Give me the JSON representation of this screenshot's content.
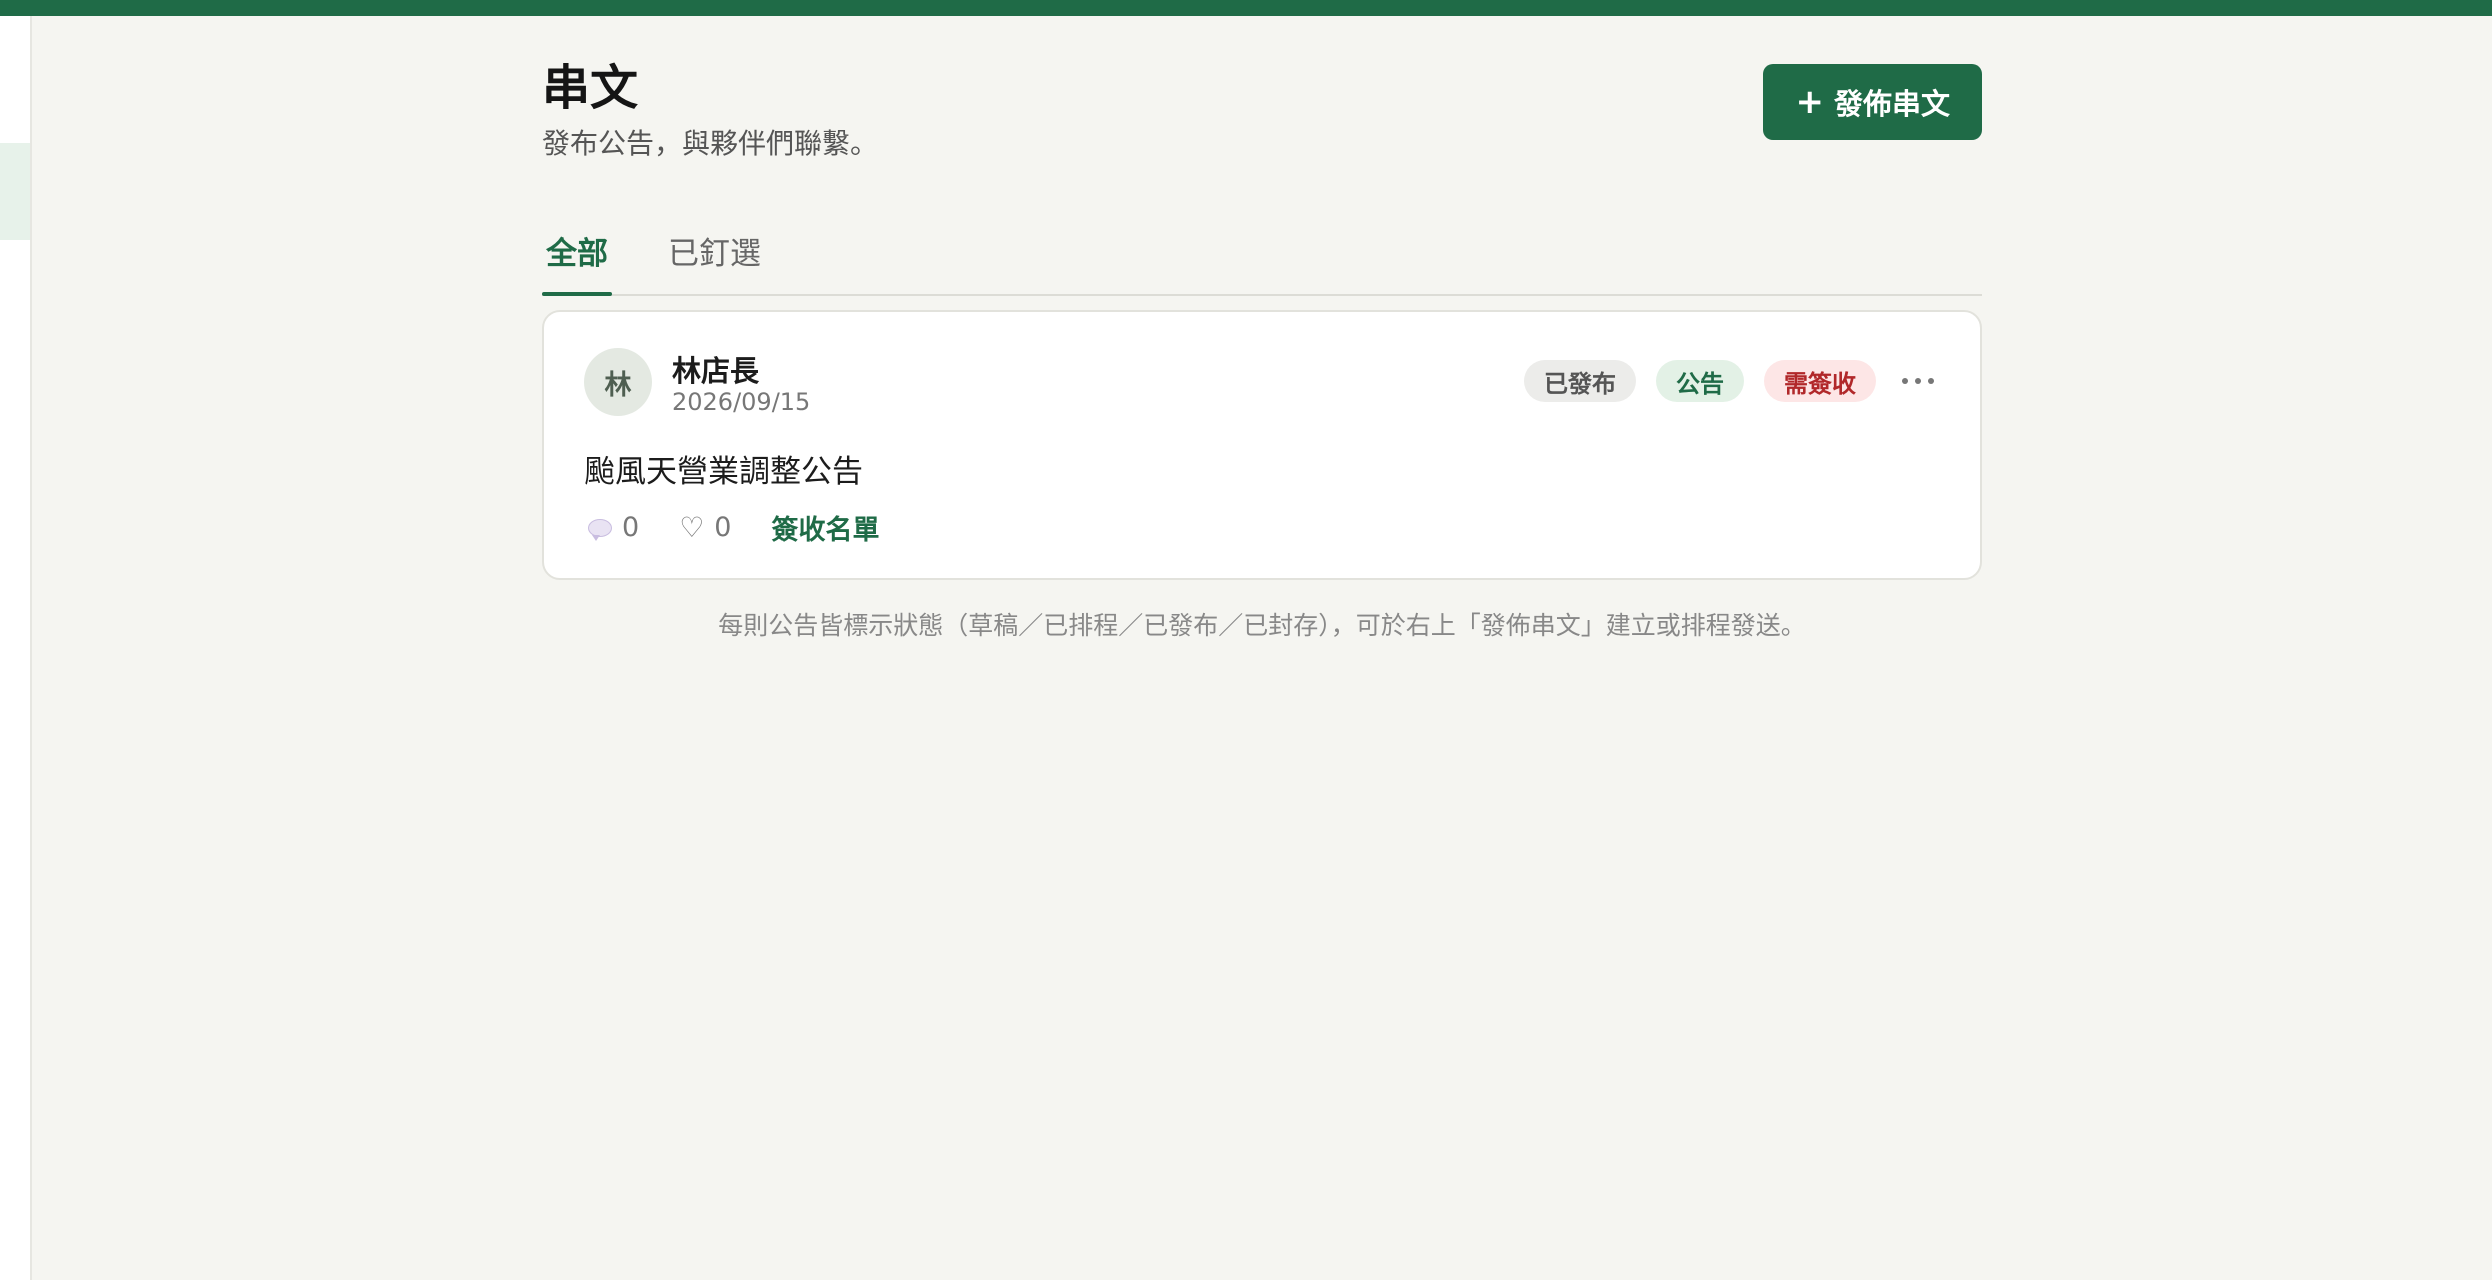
{
  "page": {
    "title": "串文",
    "subtitle": "發布公告，與夥伴們聯繫。",
    "publish_label": "發佈串文",
    "publish_icon": "plus-icon"
  },
  "tabs": [
    {
      "label": "全部",
      "active": true
    },
    {
      "label": "已釘選",
      "active": false
    }
  ],
  "post": {
    "avatar_initial": "林",
    "author": "林店長",
    "date": "2026/09/15",
    "badges": {
      "status": "已發布",
      "type": "公告",
      "signoff": "需簽收"
    },
    "body": "颱風天營業調整公告",
    "comments_count": "0",
    "likes_count": "0",
    "like_icon": "♡",
    "signoff_list_label": "簽收名單"
  },
  "hint": "每則公告皆標示狀態（草稿／已排程／已發布／已封存），可於右上「發佈串文」建立或排程發送。",
  "colors": {
    "brand": "#1f6b47",
    "background": "#f5f5f1",
    "signoff": "#b1282a"
  }
}
